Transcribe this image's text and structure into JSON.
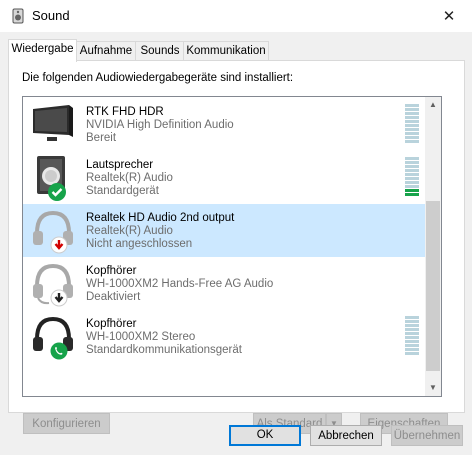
{
  "window": {
    "title": "Sound",
    "close_glyph": "✕"
  },
  "tabs": [
    {
      "label": "Wiedergabe",
      "active": true
    },
    {
      "label": "Aufnahme",
      "active": false
    },
    {
      "label": "Sounds",
      "active": false
    },
    {
      "label": "Kommunikation",
      "active": false
    }
  ],
  "intro": "Die folgenden Audiowiedergabegeräte sind installiert:",
  "devices": [
    {
      "name": "RTK FHD HDR",
      "driver": "NVIDIA High Definition Audio",
      "status": "Bereit",
      "icon": "monitor-icon",
      "meter_active": 0
    },
    {
      "name": "Lautsprecher",
      "driver": "Realtek(R) Audio",
      "status": "Standardgerät",
      "icon": "speaker-icon",
      "badge": "default-check-icon",
      "meter_active": 2
    },
    {
      "name": "Realtek HD Audio 2nd output",
      "driver": "Realtek(R) Audio",
      "status": "Nicht angeschlossen",
      "icon": "headphones-icon",
      "badge": "disconnected-arrow-icon",
      "selected": true
    },
    {
      "name": "Kopfhörer",
      "driver": "WH-1000XM2 Hands-Free AG Audio",
      "status": "Deaktiviert",
      "icon": "headset-icon",
      "badge": "disabled-arrow-icon"
    },
    {
      "name": "Kopfhörer",
      "driver": "WH-1000XM2 Stereo",
      "status": "Standardkommunikationsgerät",
      "icon": "headphones-icon",
      "badge": "communication-phone-icon",
      "meter_active": 0
    }
  ],
  "buttons": {
    "configure": "Konfigurieren",
    "set_default": "Als Standard",
    "properties": "Eigenschaften",
    "ok": "OK",
    "cancel": "Abbrechen",
    "apply": "Übernehmen"
  },
  "colors": {
    "selection": "#cce8ff",
    "accent": "#0078d7",
    "check_green": "#16a34a",
    "disconnected_red": "#d20000",
    "meter_idle": "#b9d3dc"
  }
}
